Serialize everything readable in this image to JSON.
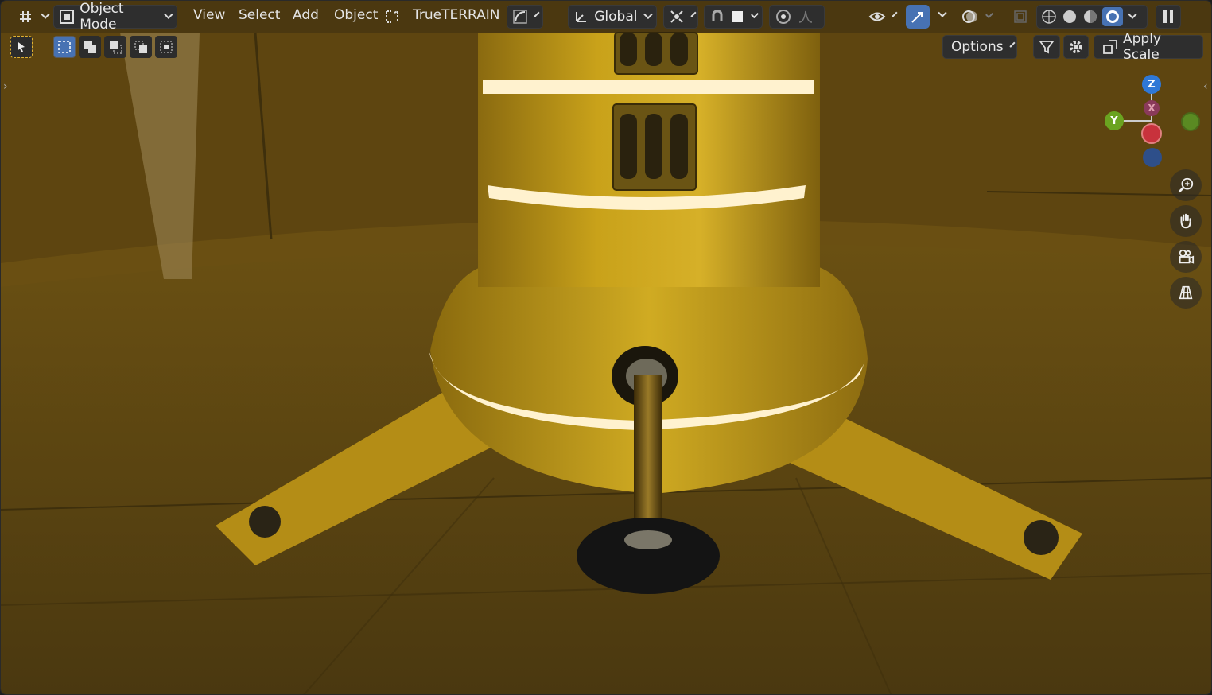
{
  "header": {
    "editor_type_icon": "grid-editor-icon",
    "mode": {
      "label": "Object Mode",
      "icon": "object-mode-icon"
    },
    "menus": [
      "View",
      "Select",
      "Add",
      "Object"
    ],
    "addon_label": "TrueTERRAIN",
    "transform_orientation": "Global"
  },
  "tool_settings": {
    "select_tool_icon": "cursor-select-icon",
    "select_modes": [
      "select-new-icon",
      "select-extend-icon",
      "select-subtract-icon",
      "select-invert-icon",
      "select-intersect-icon"
    ],
    "options_label": "Options",
    "apply_scale_label": "Apply Scale"
  },
  "gizmo": {
    "z_label": "Z",
    "y_label": "Y",
    "x_label": "X",
    "colors": {
      "x": "#c8323c",
      "y": "#6aa320",
      "z": "#2f78d6"
    }
  },
  "navigation": [
    "zoom-icon",
    "pan-hand-icon",
    "camera-view-icon",
    "ortho-grid-icon"
  ],
  "colors": {
    "accent": "#4772b3",
    "header_bg": "#2e2e2e"
  }
}
